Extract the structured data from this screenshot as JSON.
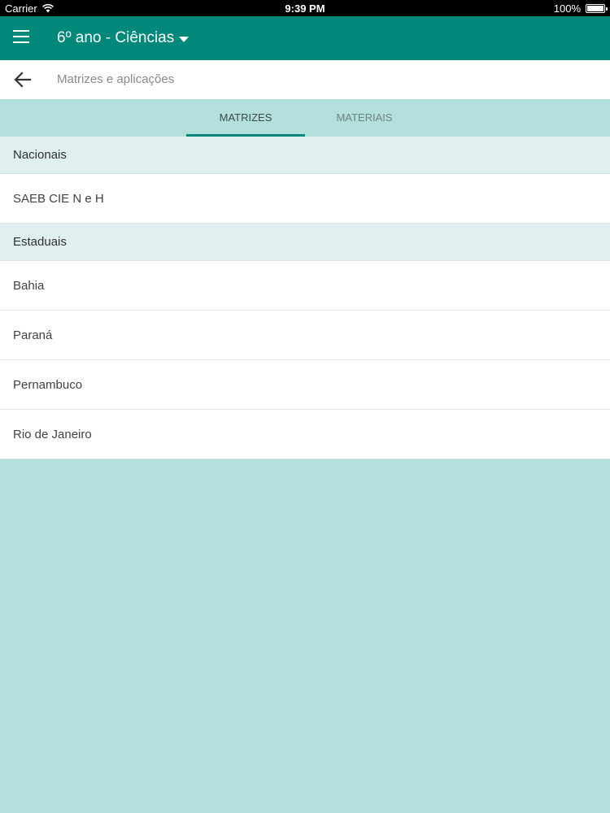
{
  "status_bar": {
    "carrier": "Carrier",
    "time": "9:39 PM",
    "battery": "100%",
    "battery_level": 1.0
  },
  "app_bar": {
    "title": "6º ano - Ciências",
    "menu_icon": "menu-icon",
    "dropdown_icon": "caret-down-icon",
    "color": "#00897b"
  },
  "sub_bar": {
    "back_icon": "arrow-left-icon",
    "title": "Matrizes e aplicações"
  },
  "tabs": [
    {
      "label": "MATRIZES",
      "active": true
    },
    {
      "label": "MATERIAIS",
      "active": false
    }
  ],
  "sections": [
    {
      "header": "Nacionais",
      "items": [
        "SAEB CIE N e H"
      ]
    },
    {
      "header": "Estaduais",
      "items": [
        "Bahia",
        "Paraná",
        "Pernambuco",
        "Rio de Janeiro"
      ]
    }
  ]
}
